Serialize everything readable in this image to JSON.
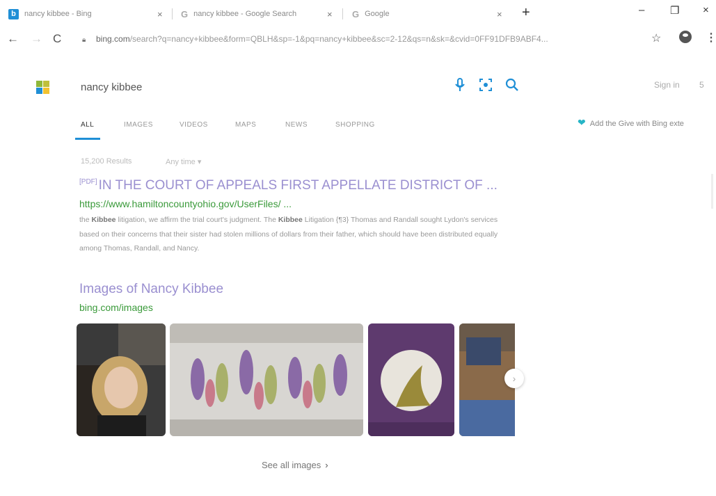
{
  "tabs": [
    {
      "title": "nancy kibbee - Bing",
      "favicon": "bing-icon",
      "close": "×"
    },
    {
      "title": "nancy kibbee - Google Search",
      "favicon": "google-icon",
      "close": "×"
    },
    {
      "title": "Google",
      "favicon": "google-icon",
      "close": "×"
    }
  ],
  "new_tab_label": "+",
  "window_controls": {
    "minimize": "–",
    "restore": "❐",
    "close": "×"
  },
  "toolbar": {
    "back": "←",
    "forward": "→",
    "reload": "C",
    "url_host": "bing.com",
    "url_rest": "/search?q=nancy+kibbee&form=QBLH&sp=-1&pq=nancy+kibbee&sc=2-12&qs=n&sk=&cvid=0FF91DFB9ABF4...",
    "star": "☆",
    "menu": "⋮"
  },
  "search": {
    "query": "nancy kibbee",
    "mic_icon": "🎙",
    "visual_icon": "⊙",
    "search_icon": "⌕",
    "signin_label": "Sign in",
    "signin_extra": "5"
  },
  "nav_tabs": [
    "ALL",
    "IMAGES",
    "VIDEOS",
    "MAPS",
    "NEWS",
    "SHOPPING"
  ],
  "give_banner": {
    "icon": "❤",
    "text": "Add the Give with Bing exte"
  },
  "results_meta": {
    "count": "15,200 Results",
    "time_filter": "Any time ▾"
  },
  "result1": {
    "pdf_tag": "[PDF]",
    "title": "IN THE COURT OF APPEALS FIRST APPELLATE DISTRICT OF ...",
    "url": "https://www.hamiltoncountyohio.gov/UserFiles/ ...",
    "snippet_1a": "the ",
    "snippet_1b": "Kibbee",
    "snippet_1c": " litigation, we affirm the trial court's judgment. The ",
    "snippet_1d": "Kibbee",
    "snippet_1e": " Litigation {¶3} Thomas and Randall sought Lydon's services based on their concerns that their sister had stolen millions of dollars from their father, which should have been distributed equally among Thomas, Randall, and Nancy."
  },
  "images_block": {
    "title": "Images of Nancy Kibbee",
    "url": "bing.com/images",
    "see_all": "See all images",
    "see_all_chev": "›",
    "next": "›"
  },
  "colors": {
    "accent": "#1f8fd6",
    "link_visited": "#9a8fd0",
    "url_green": "#3a9a3a"
  }
}
